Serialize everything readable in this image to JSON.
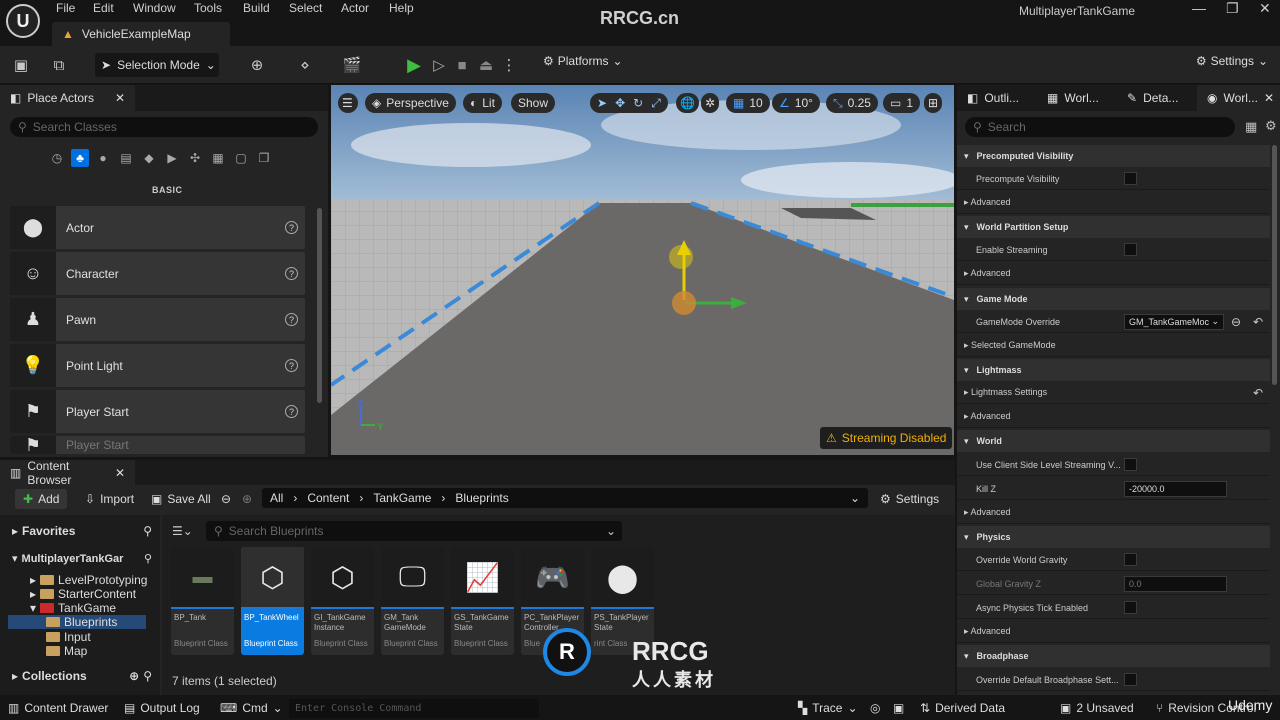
{
  "menu": [
    "File",
    "Edit",
    "Window",
    "Tools",
    "Build",
    "Select",
    "Actor",
    "Help"
  ],
  "level_tab": "VehicleExampleMap",
  "project_name": "MultiplayerTankGame",
  "watermark_top": "RRCG.cn",
  "toolbar": {
    "selection_mode": "Selection Mode",
    "platforms": "Platforms",
    "settings": "Settings"
  },
  "place_actors": {
    "tab": "Place Actors",
    "search_placeholder": "Search Classes",
    "category": "BASIC",
    "items": [
      {
        "label": "Actor",
        "icon": "actor-sphere-icon"
      },
      {
        "label": "Character",
        "icon": "character-icon"
      },
      {
        "label": "Pawn",
        "icon": "pawn-icon"
      },
      {
        "label": "Point Light",
        "icon": "lightbulb-icon"
      },
      {
        "label": "Player Start",
        "icon": "player-start-icon"
      },
      {
        "label": "Player Start",
        "icon": "player-start-icon"
      }
    ]
  },
  "viewport": {
    "perspective": "Perspective",
    "lit": "Lit",
    "show": "Show",
    "grid_snap": "10",
    "rot_snap": "10°",
    "scale_snap": "0.25",
    "camera_speed": "1",
    "streaming": "Streaming Disabled",
    "axis_z": "Z",
    "axis_y": "Y"
  },
  "right_panel": {
    "tabs": [
      "Outli...",
      "Worl...",
      "Deta...",
      "Worl..."
    ],
    "search_placeholder": "Search",
    "sections": {
      "precomputed": "Precomputed Visibility",
      "precompute_vis": "Precompute Visibility",
      "advanced": "Advanced",
      "world_partition": "World Partition Setup",
      "enable_streaming": "Enable Streaming",
      "game_mode": "Game Mode",
      "gamemode_override": "GameMode Override",
      "gamemode_value": "GM_TankGameMoc",
      "selected_gamemode": "Selected GameMode",
      "lightmass": "Lightmass",
      "lightmass_settings": "Lightmass Settings",
      "world": "World",
      "client_side": "Use Client Side Level Streaming V...",
      "kill_z": "Kill Z",
      "kill_z_value": "-20000.0",
      "physics": "Physics",
      "override_gravity": "Override World Gravity",
      "global_gravity": "Global Gravity Z",
      "global_gravity_value": "0.0",
      "async_physics": "Async Physics Tick Enabled",
      "broadphase": "Broadphase",
      "override_broadphase": "Override Default Broadphase Sett..."
    }
  },
  "content_browser": {
    "tab": "Content Browser",
    "add": "Add",
    "import": "Import",
    "save_all": "Save All",
    "breadcrumb": [
      "All",
      "Content",
      "TankGame",
      "Blueprints"
    ],
    "settings": "Settings",
    "favorites": "Favorites",
    "project_root": "MultiplayerTankGar",
    "tree": [
      "LevelPrototyping",
      "StarterContent",
      "TankGame",
      "Blueprints",
      "Input",
      "Map"
    ],
    "collections": "Collections",
    "search_placeholder": "Search Blueprints",
    "items_count": "7 items (1 selected)",
    "assets": [
      {
        "name": "BP_Tank",
        "type": "Blueprint Class"
      },
      {
        "name": "BP_TankWheel",
        "type": "Blueprint Class"
      },
      {
        "name": "GI_TankGame Instance",
        "type": "Blueprint Class"
      },
      {
        "name": "GM_Tank GameMode",
        "type": "Blueprint Class"
      },
      {
        "name": "GS_TankGame State",
        "type": "Blueprint Class"
      },
      {
        "name": "PC_TankPlayer Controller",
        "type": "Blue"
      },
      {
        "name": "PS_TankPlayer State",
        "type": "rint Class"
      }
    ]
  },
  "status_bar": {
    "content_drawer": "Content Drawer",
    "output_log": "Output Log",
    "cmd": "Cmd",
    "console_placeholder": "Enter Console Command",
    "trace": "Trace",
    "derived_data": "Derived Data",
    "unsaved": "2 Unsaved",
    "revision": "Revision Control",
    "udemy": "Udemy"
  },
  "watermark_logo": {
    "top": "RRCG",
    "bottom": "人人素材"
  }
}
